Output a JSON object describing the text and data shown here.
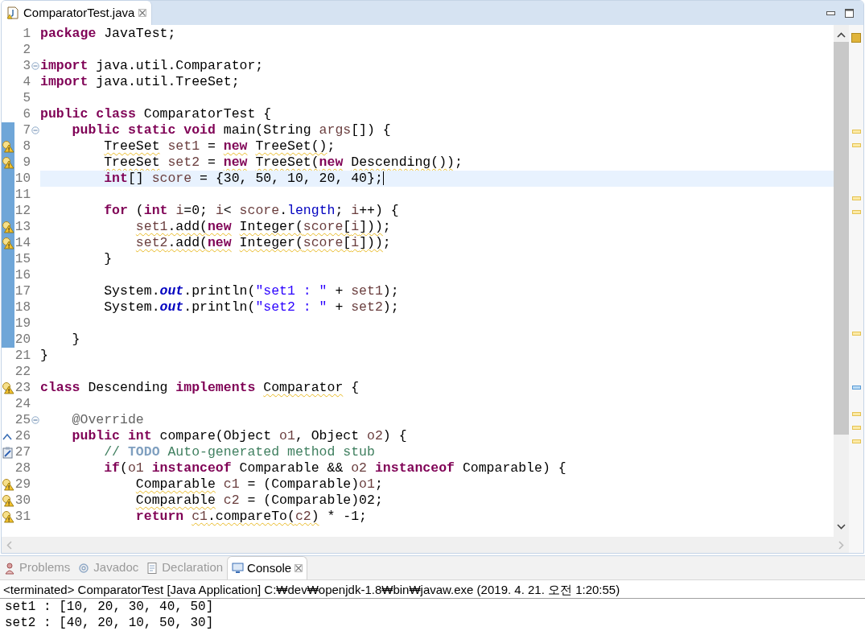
{
  "editor_tabs": [
    {
      "label": "ComparatorTest.java",
      "selected": true
    }
  ],
  "code_lines": [
    {
      "number": "1",
      "fold": false,
      "changed": false,
      "current": false,
      "segments": [
        {
          "text": "package",
          "kind": "keyword",
          "warning": false
        },
        {
          "text": " JavaTest;",
          "kind": "plain",
          "warning": false
        }
      ]
    },
    {
      "number": "2",
      "fold": false,
      "changed": false,
      "current": false
    },
    {
      "number": "3",
      "fold": true,
      "changed": false,
      "current": false,
      "segments": [
        {
          "text": "import",
          "kind": "keyword",
          "warning": false
        },
        {
          "text": " java.util.Comparator;",
          "kind": "plain",
          "warning": false
        }
      ]
    },
    {
      "number": "4",
      "fold": false,
      "changed": false,
      "current": false,
      "segments": [
        {
          "text": "import",
          "kind": "keyword",
          "warning": false
        },
        {
          "text": " java.util.TreeSet;",
          "kind": "plain",
          "warning": false
        }
      ]
    },
    {
      "number": "5",
      "fold": false,
      "changed": false,
      "current": false
    },
    {
      "number": "6",
      "fold": false,
      "changed": false,
      "current": false,
      "segments": [
        {
          "text": "public class",
          "kind": "keyword",
          "warning": false
        },
        {
          "text": " ComparatorTest {",
          "kind": "plain",
          "warning": false
        }
      ]
    },
    {
      "number": "7",
      "fold": true,
      "changed": true,
      "current": false,
      "segments": [
        {
          "text": "    public static void",
          "kind": "keyword",
          "warning": false
        },
        {
          "text": " main(String ",
          "kind": "plain",
          "warning": false
        },
        {
          "text": "args",
          "kind": "variable",
          "warning": false
        },
        {
          "text": "[]) {",
          "kind": "plain",
          "warning": false
        }
      ]
    },
    {
      "number": "8",
      "kind": "warning",
      "fold": false,
      "changed": true,
      "current": false,
      "segments": [
        {
          "text": "        TreeSet",
          "kind": "plain",
          "warning": true
        },
        {
          "text": " set1",
          "kind": "variable",
          "warning": false
        },
        {
          "text": " = ",
          "kind": "plain",
          "warning": false
        },
        {
          "text": "new",
          "kind": "keyword",
          "warning": true
        },
        {
          "text": " TreeSet()",
          "kind": "plain",
          "warning": true
        },
        {
          "text": ";",
          "kind": "plain",
          "warning": false
        }
      ]
    },
    {
      "number": "9",
      "kind": "warning",
      "fold": false,
      "changed": true,
      "current": false,
      "segments": [
        {
          "text": "        TreeSet",
          "kind": "plain",
          "warning": true
        },
        {
          "text": " set2",
          "kind": "variable",
          "warning": false
        },
        {
          "text": " = ",
          "kind": "plain",
          "warning": false
        },
        {
          "text": "new",
          "kind": "keyword",
          "warning": true
        },
        {
          "text": " TreeSet(",
          "kind": "plain",
          "warning": true
        },
        {
          "text": "new",
          "kind": "keyword",
          "warning": true
        },
        {
          "text": " Descending())",
          "kind": "plain",
          "warning": true
        },
        {
          "text": ";",
          "kind": "plain",
          "warning": false
        }
      ]
    },
    {
      "number": "10",
      "fold": false,
      "changed": true,
      "current": true,
      "segments": [
        {
          "text": "        int",
          "kind": "keyword",
          "warning": false
        },
        {
          "text": "[] ",
          "kind": "plain",
          "warning": false
        },
        {
          "text": "score",
          "kind": "variable",
          "warning": false
        },
        {
          "text": " = {30, 50, 10, 20, 40};",
          "kind": "plain",
          "warning": false
        }
      ]
    },
    {
      "number": "11",
      "fold": false,
      "changed": true,
      "current": false
    },
    {
      "number": "12",
      "fold": false,
      "changed": true,
      "current": false,
      "segments": [
        {
          "text": "        for",
          "kind": "keyword",
          "warning": false
        },
        {
          "text": " (",
          "kind": "plain",
          "warning": false
        },
        {
          "text": "int",
          "kind": "keyword",
          "warning": false
        },
        {
          "text": " i",
          "kind": "variable",
          "warning": false
        },
        {
          "text": "=0; ",
          "kind": "plain",
          "warning": false
        },
        {
          "text": "i",
          "kind": "variable",
          "warning": false
        },
        {
          "text": "< ",
          "kind": "plain",
          "warning": false
        },
        {
          "text": "score",
          "kind": "variable",
          "warning": false
        },
        {
          "text": ".",
          "kind": "plain",
          "warning": false
        },
        {
          "text": "length",
          "kind": "field",
          "warning": false
        },
        {
          "text": "; ",
          "kind": "plain",
          "warning": false
        },
        {
          "text": "i",
          "kind": "variable",
          "warning": false
        },
        {
          "text": "++) {",
          "kind": "plain",
          "warning": false
        }
      ]
    },
    {
      "number": "13",
      "kind": "warning",
      "fold": false,
      "changed": true,
      "current": false,
      "segments": [
        {
          "text": "            set1",
          "kind": "variable",
          "warning": true
        },
        {
          "text": ".add(",
          "kind": "plain",
          "warning": true
        },
        {
          "text": "new",
          "kind": "keyword",
          "warning": true
        },
        {
          "text": " Integer(",
          "kind": "plain",
          "warning": true
        },
        {
          "text": "score",
          "kind": "variable",
          "warning": true
        },
        {
          "text": "[",
          "kind": "plain",
          "warning": true
        },
        {
          "text": "i",
          "kind": "variable",
          "warning": true
        },
        {
          "text": "]))",
          "kind": "plain",
          "warning": true
        },
        {
          "text": ";",
          "kind": "plain",
          "warning": false
        }
      ]
    },
    {
      "number": "14",
      "kind": "warning",
      "fold": false,
      "changed": true,
      "current": false,
      "segments": [
        {
          "text": "            set2",
          "kind": "variable",
          "warning": true
        },
        {
          "text": ".add(",
          "kind": "plain",
          "warning": true
        },
        {
          "text": "new",
          "kind": "keyword",
          "warning": true
        },
        {
          "text": " Integer(",
          "kind": "plain",
          "warning": true
        },
        {
          "text": "score",
          "kind": "variable",
          "warning": true
        },
        {
          "text": "[",
          "kind": "plain",
          "warning": true
        },
        {
          "text": "i",
          "kind": "variable",
          "warning": true
        },
        {
          "text": "]))",
          "kind": "plain",
          "warning": true
        },
        {
          "text": ";",
          "kind": "plain",
          "warning": false
        }
      ]
    },
    {
      "number": "15",
      "fold": false,
      "changed": true,
      "current": false,
      "segments": [
        {
          "text": "        }",
          "kind": "plain",
          "warning": false
        }
      ]
    },
    {
      "number": "16",
      "fold": false,
      "changed": true,
      "current": false
    },
    {
      "number": "17",
      "fold": false,
      "changed": true,
      "current": false,
      "segments": [
        {
          "text": "        System.",
          "kind": "plain",
          "warning": false
        },
        {
          "text": "out",
          "kind": "static_field",
          "warning": false
        },
        {
          "text": ".println(",
          "kind": "plain",
          "warning": false
        },
        {
          "text": "\"set1 : \"",
          "kind": "string",
          "warning": false
        },
        {
          "text": " + ",
          "kind": "plain",
          "warning": false
        },
        {
          "text": "set1",
          "kind": "variable",
          "warning": false
        },
        {
          "text": ");",
          "kind": "plain",
          "warning": false
        }
      ]
    },
    {
      "number": "18",
      "fold": false,
      "changed": true,
      "current": false,
      "segments": [
        {
          "text": "        System.",
          "kind": "plain",
          "warning": false
        },
        {
          "text": "out",
          "kind": "static_field",
          "warning": false
        },
        {
          "text": ".println(",
          "kind": "plain",
          "warning": false
        },
        {
          "text": "\"set2 : \"",
          "kind": "string",
          "warning": false
        },
        {
          "text": " + ",
          "kind": "plain",
          "warning": false
        },
        {
          "text": "set2",
          "kind": "variable",
          "warning": false
        },
        {
          "text": ");",
          "kind": "plain",
          "warning": false
        }
      ]
    },
    {
      "number": "19",
      "fold": false,
      "changed": true,
      "current": false
    },
    {
      "number": "20",
      "fold": false,
      "changed": true,
      "current": false,
      "segments": [
        {
          "text": "    }",
          "kind": "plain",
          "warning": false
        }
      ]
    },
    {
      "number": "21",
      "fold": false,
      "changed": false,
      "current": false,
      "segments": [
        {
          "text": "}",
          "kind": "plain",
          "warning": false
        }
      ]
    },
    {
      "number": "22",
      "fold": false,
      "changed": false,
      "current": false
    },
    {
      "number": "23",
      "kind": "warning",
      "fold": false,
      "changed": false,
      "current": false,
      "segments": [
        {
          "text": "class",
          "kind": "keyword",
          "warning": false
        },
        {
          "text": " Descending ",
          "kind": "plain",
          "warning": false
        },
        {
          "text": "implements ",
          "kind": "keyword",
          "warning": false
        },
        {
          "text": "Comparator",
          "kind": "plain",
          "warning": true
        },
        {
          "text": " {",
          "kind": "plain",
          "warning": false
        }
      ]
    },
    {
      "number": "24",
      "fold": false,
      "changed": false,
      "current": false
    },
    {
      "number": "25",
      "fold": true,
      "changed": false,
      "current": false,
      "segments": [
        {
          "text": "    @Override",
          "kind": "annotation",
          "warning": false
        }
      ]
    },
    {
      "number": "26",
      "kind": "override",
      "fold": false,
      "changed": false,
      "current": false,
      "segments": [
        {
          "text": "    public int",
          "kind": "keyword",
          "warning": false
        },
        {
          "text": " compare(Object ",
          "kind": "plain",
          "warning": false
        },
        {
          "text": "o1",
          "kind": "variable",
          "warning": false
        },
        {
          "text": ", Object ",
          "kind": "plain",
          "warning": false
        },
        {
          "text": "o2",
          "kind": "variable",
          "warning": false
        },
        {
          "text": ") {",
          "kind": "plain",
          "warning": false
        }
      ]
    },
    {
      "number": "27",
      "kind": "task",
      "fold": false,
      "changed": false,
      "current": false,
      "segments": [
        {
          "text": "        // ",
          "kind": "comment",
          "warning": false
        },
        {
          "text": "TODO",
          "kind": "todo",
          "warning": false
        },
        {
          "text": " Auto-generated method stub",
          "kind": "comment",
          "warning": false
        }
      ]
    },
    {
      "number": "28",
      "fold": false,
      "changed": false,
      "current": false,
      "segments": [
        {
          "text": "        if",
          "kind": "keyword",
          "warning": false
        },
        {
          "text": "(",
          "kind": "plain",
          "warning": false
        },
        {
          "text": "o1 ",
          "kind": "variable",
          "warning": false
        },
        {
          "text": "instanceof",
          "kind": "keyword",
          "warning": false
        },
        {
          "text": " Comparable && ",
          "kind": "plain",
          "warning": false
        },
        {
          "text": "o2 ",
          "kind": "variable",
          "warning": false
        },
        {
          "text": "instanceof",
          "kind": "keyword",
          "warning": false
        },
        {
          "text": " Comparable) {",
          "kind": "plain",
          "warning": false
        }
      ]
    },
    {
      "number": "29",
      "kind": "warning",
      "fold": false,
      "changed": false,
      "current": false,
      "segments": [
        {
          "text": "            Comparable",
          "kind": "plain",
          "warning": true
        },
        {
          "text": " c1",
          "kind": "variable",
          "warning": false
        },
        {
          "text": " = (Comparable)",
          "kind": "plain",
          "warning": false
        },
        {
          "text": "o1",
          "kind": "variable",
          "warning": false
        },
        {
          "text": ";",
          "kind": "plain",
          "warning": false
        }
      ]
    },
    {
      "number": "30",
      "kind": "warning",
      "fold": false,
      "changed": false,
      "current": false,
      "segments": [
        {
          "text": "            Comparable",
          "kind": "plain",
          "warning": true
        },
        {
          "text": " c2",
          "kind": "variable",
          "warning": false
        },
        {
          "text": " = (Comparable)02;",
          "kind": "plain",
          "warning": false
        }
      ]
    },
    {
      "number": "31",
      "kind": "warning",
      "fold": false,
      "changed": false,
      "current": false,
      "segments": [
        {
          "text": "            return ",
          "kind": "keyword",
          "warning": false
        },
        {
          "text": "c1",
          "kind": "variable",
          "warning": true
        },
        {
          "text": ".compareTo(",
          "kind": "plain",
          "warning": true
        },
        {
          "text": "c2",
          "kind": "variable",
          "warning": true
        },
        {
          "text": ")",
          "kind": "plain",
          "warning": true
        },
        {
          "text": " * -1;",
          "kind": "plain",
          "warning": false
        }
      ]
    }
  ],
  "view_tabs": [
    {
      "label": "Problems",
      "kind": "problems",
      "selected": false
    },
    {
      "label": "Javadoc",
      "kind": "javadoc",
      "selected": false
    },
    {
      "label": "Declaration",
      "kind": "declaration",
      "selected": false
    },
    {
      "label": "Console",
      "kind": "console",
      "selected": true
    }
  ],
  "console": {
    "header": "<terminated> ComparatorTest [Java Application] C:₩dev₩openjdk-1.8₩bin₩javaw.exe (2019. 4. 21. 오전 1:20:55)",
    "output": [
      "set1 : [10, 20, 30, 40, 50]",
      "set2 : [40, 20, 10, 50, 30]"
    ]
  }
}
